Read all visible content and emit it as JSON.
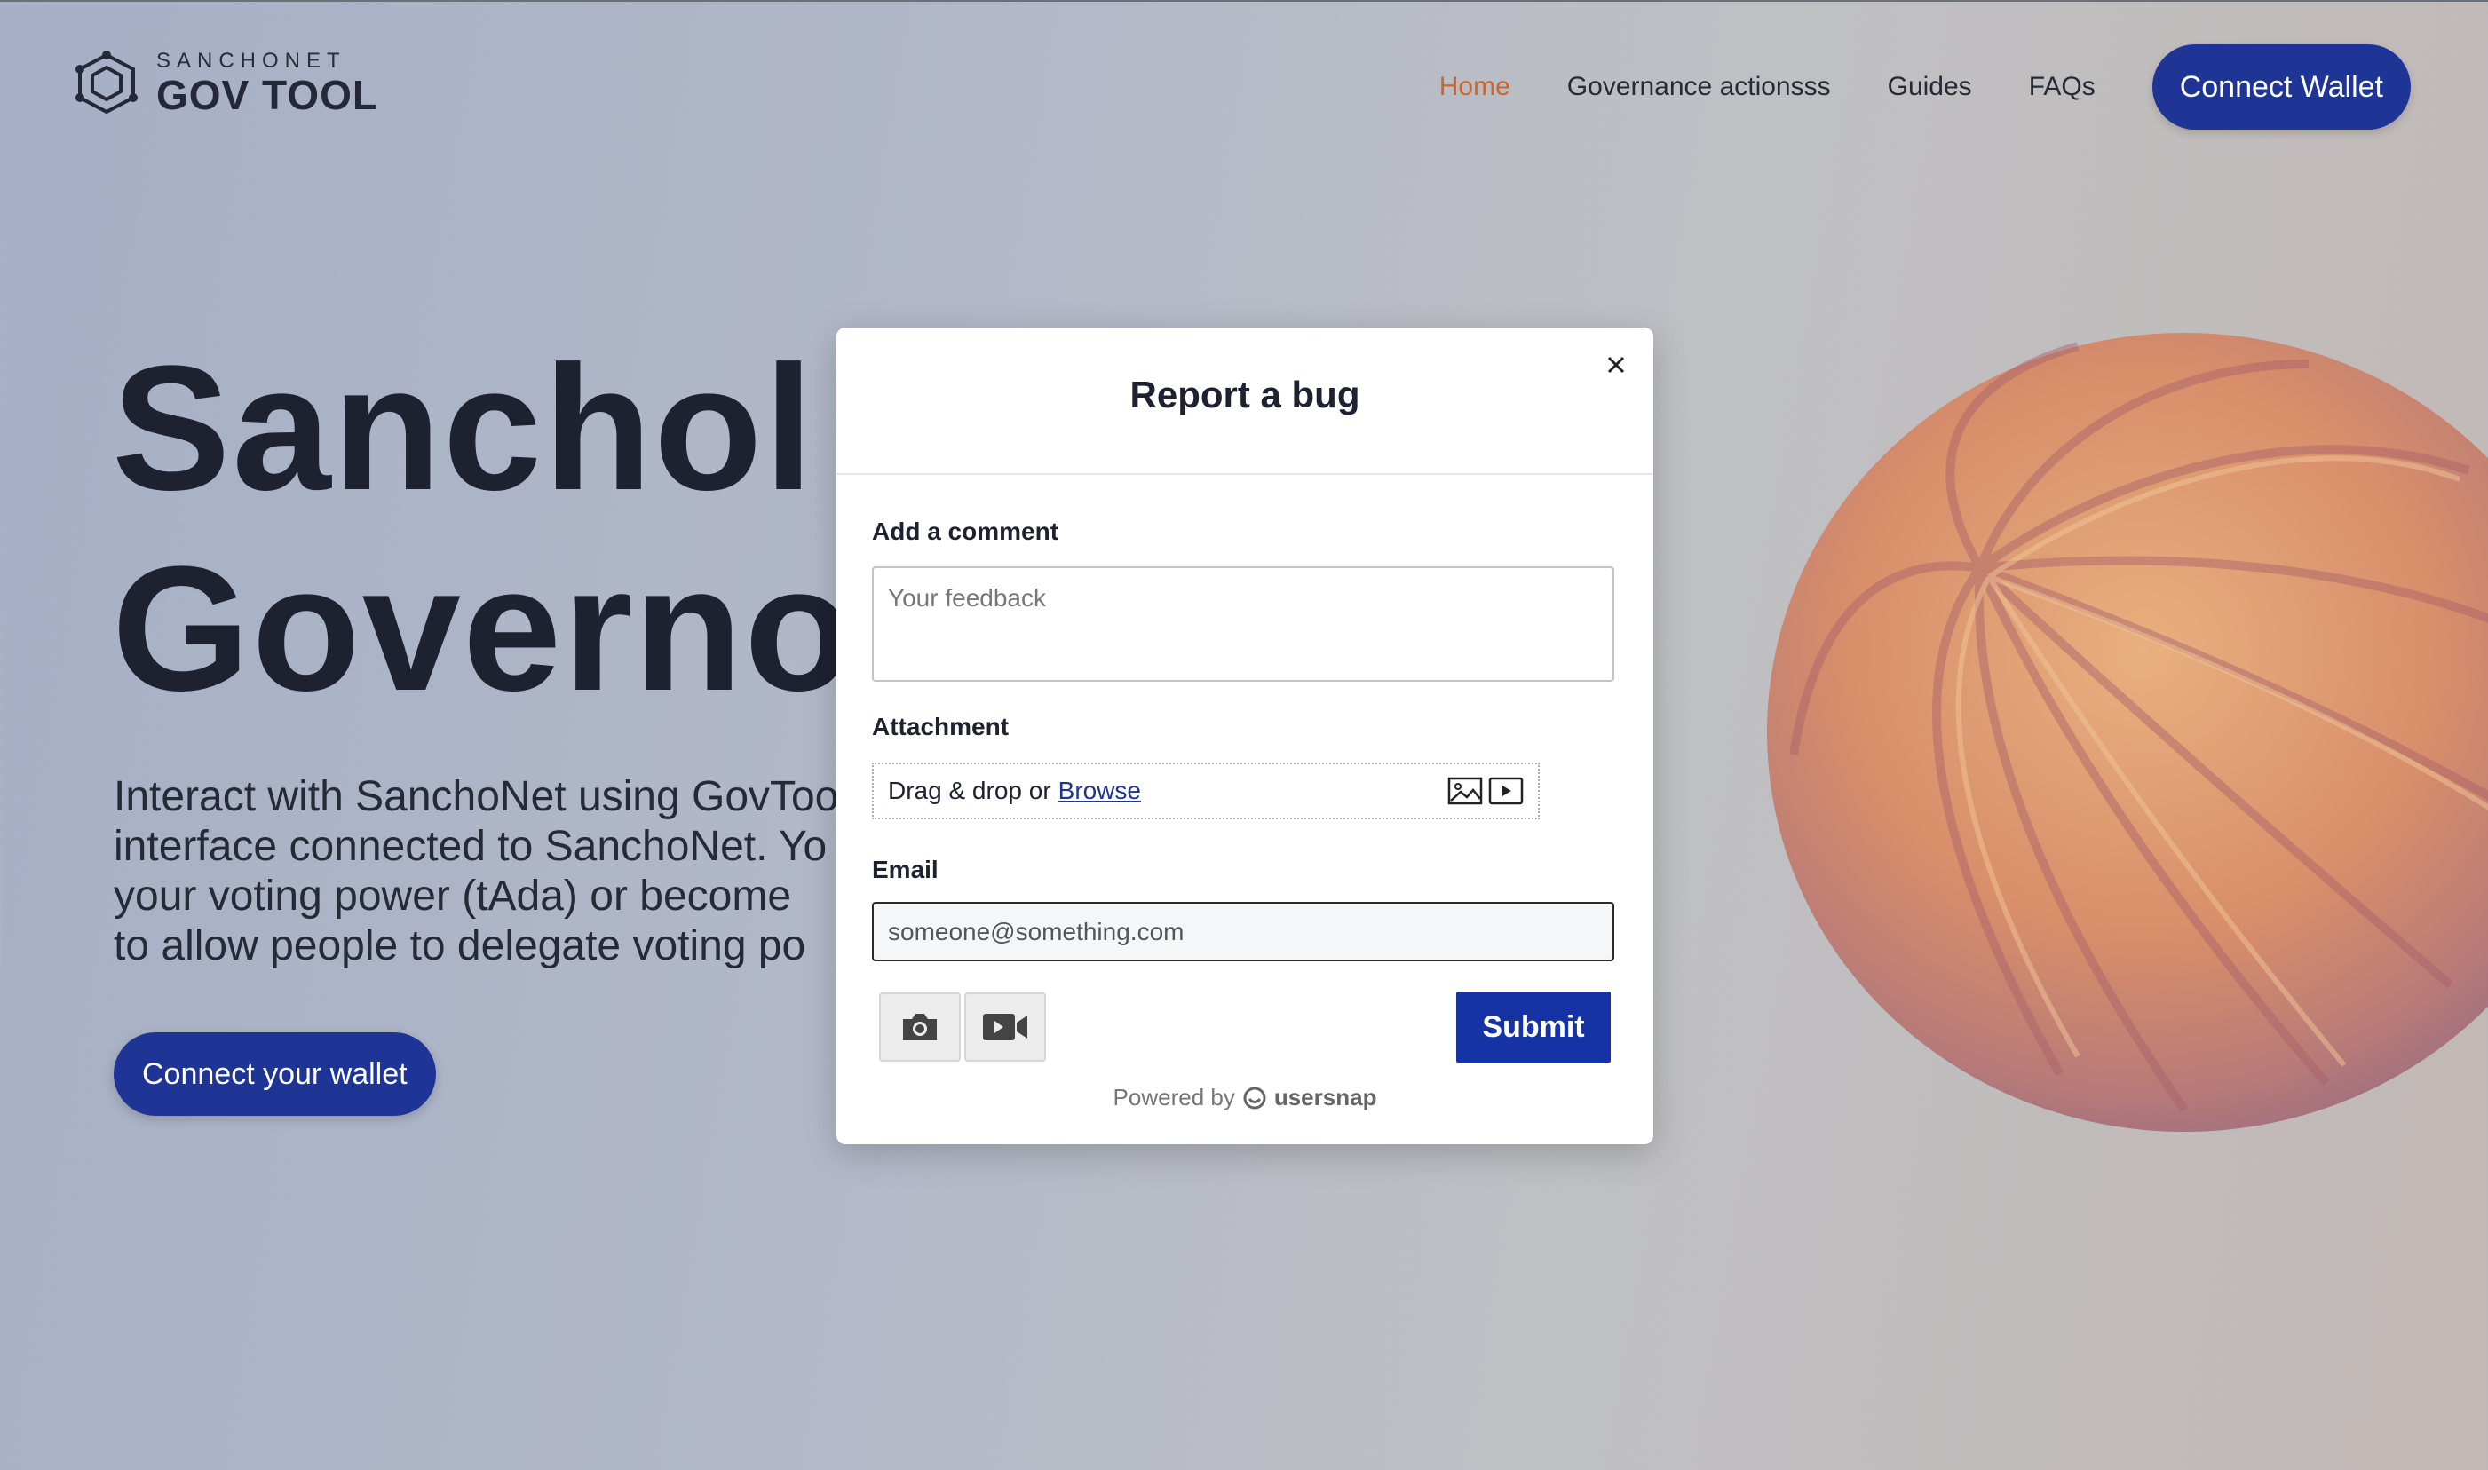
{
  "header": {
    "logo_sub": "SANCHONET",
    "logo_main": "GOV TOOL",
    "nav": [
      "Home",
      "Governance actionsss",
      "Guides",
      "FAQs"
    ],
    "active_nav": "Home",
    "connect_button": "Connect Wallet"
  },
  "hero": {
    "title_line1": "Sanchol",
    "title_line2": "Governo",
    "desc_lines": [
      "Interact with SanchoNet using GovToo",
      "interface connected to SanchoNet. Yo",
      "your voting power (tAda) or become",
      "to allow people to delegate voting po"
    ],
    "cta": "Connect your wallet"
  },
  "modal": {
    "title": "Report a bug",
    "comment_label": "Add a comment",
    "comment_placeholder": "Your feedback",
    "attachment_label": "Attachment",
    "attach_text": "Drag & drop or",
    "attach_browse": "Browse",
    "email_label": "Email",
    "email_value": "someone@something.com",
    "submit": "Submit",
    "powered_by": "Powered by",
    "brand": "usersnap"
  },
  "colors": {
    "primary": "#1f3596",
    "active_nav": "#d0652a",
    "submit": "#1533a4"
  },
  "icons": [
    "logo-icon",
    "close-icon",
    "image-icon",
    "video-icon",
    "camera-icon",
    "video-record-icon",
    "usersnap-logo-icon"
  ]
}
